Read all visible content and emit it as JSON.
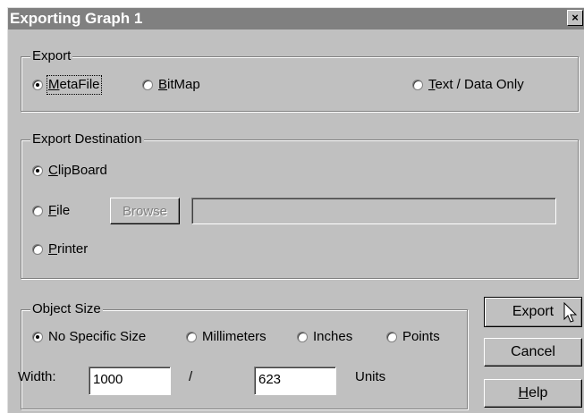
{
  "window": {
    "title": "Exporting Graph 1",
    "close_glyph": "×"
  },
  "export_group": {
    "legend": "Export",
    "options": [
      {
        "pre": "",
        "u": "M",
        "post": "etaFile",
        "selected": true
      },
      {
        "pre": "",
        "u": "B",
        "post": "itMap",
        "selected": false
      },
      {
        "pre": "",
        "u": "T",
        "post": "ext / Data Only",
        "selected": false
      }
    ]
  },
  "destination_group": {
    "legend": "Export Destination",
    "clipboard": {
      "pre": "",
      "u": "C",
      "post": "lipBoard",
      "selected": true
    },
    "file": {
      "pre": "",
      "u": "F",
      "post": "ile",
      "selected": false
    },
    "printer": {
      "pre": "",
      "u": "P",
      "post": "rinter",
      "selected": false
    },
    "browse_label": "Browse",
    "file_path_value": ""
  },
  "size_group": {
    "legend": "Object Size",
    "options": [
      {
        "label": "No Specific Size",
        "selected": true
      },
      {
        "label": "Millimeters",
        "selected": false
      },
      {
        "label": "Inches",
        "selected": false
      },
      {
        "label": "Points",
        "selected": false
      }
    ],
    "width_label": "Width:",
    "width_value": "1000",
    "separator": "/",
    "height_value": "623",
    "units_label": "Units"
  },
  "buttons": {
    "export": "Export",
    "cancel": "Cancel",
    "help_pre": "",
    "help_u": "H",
    "help_post": "elp"
  },
  "icons": {
    "close": "close-icon",
    "cursor": "mouse-pointer-icon"
  }
}
